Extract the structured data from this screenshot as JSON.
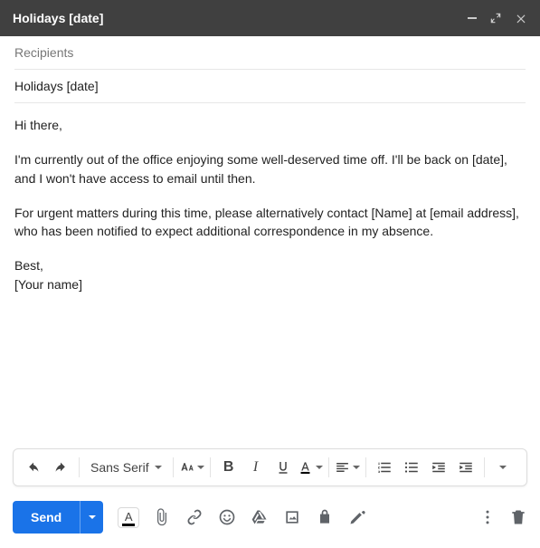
{
  "header": {
    "title": "Holidays [date]"
  },
  "fields": {
    "recipients_placeholder": "Recipients",
    "subject": "Holidays [date]"
  },
  "body": {
    "greeting": "Hi there,",
    "para1": "I'm currently out of the office enjoying some well-deserved time off. I'll be back on [date], and I won't have access to email until then.",
    "para2": "For urgent matters during this time, please alternatively contact [Name] at [email address], who has been notified to expect additional correspondence in my absence.",
    "closing": "Best,",
    "signature": "[Your name]"
  },
  "format": {
    "font": "Sans Serif"
  },
  "actions": {
    "send": "Send"
  }
}
